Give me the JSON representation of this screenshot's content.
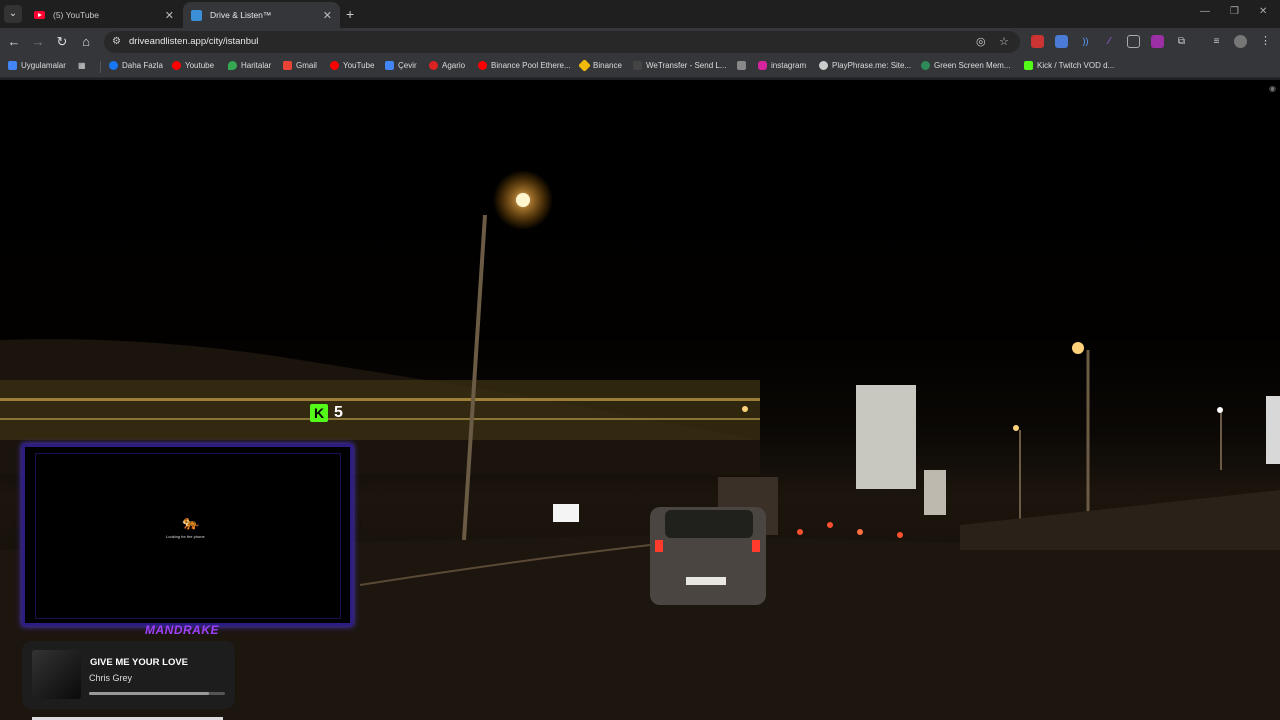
{
  "browser": {
    "tabs": [
      {
        "title": "(5) YouTube",
        "active": false
      },
      {
        "title": "Drive & Listen™",
        "active": true
      }
    ],
    "url": "driveandlisten.app/city/istanbul",
    "bookmarks": [
      {
        "label": "Uygulamalar",
        "icon": "apps-icon"
      },
      {
        "label": "Daha Fazla",
        "icon": "facebook-icon"
      },
      {
        "label": "Youtube",
        "icon": "youtube-icon"
      },
      {
        "label": "Haritalar",
        "icon": "maps-icon"
      },
      {
        "label": "Gmail",
        "icon": "gmail-icon"
      },
      {
        "label": "YouTube",
        "icon": "youtube-icon"
      },
      {
        "label": "Çevir",
        "icon": "translate-icon"
      },
      {
        "label": "Agario",
        "icon": "agario-icon"
      },
      {
        "label": "Binance Pool Ethere...",
        "icon": "youtube-icon"
      },
      {
        "label": "Binance",
        "icon": "binance-icon"
      },
      {
        "label": "WeTransfer - Send L...",
        "icon": "wetransfer-icon"
      },
      {
        "label": "",
        "icon": "bookmark-icon"
      },
      {
        "label": "instagram",
        "icon": "instagram-icon"
      },
      {
        "label": "PlayPhrase.me: Site...",
        "icon": "playphrase-icon"
      },
      {
        "label": "Green Screen Mem...",
        "icon": "greenscreen-icon"
      },
      {
        "label": "Kick / Twitch VOD d...",
        "icon": "kick-icon"
      }
    ]
  },
  "overlay": {
    "kick_viewers": "5",
    "webcam_caption": "Looking for the phone",
    "streamer_name": "MANDRAKE"
  },
  "player": {
    "song": "GIVE ME YOUR LOVE",
    "artist": "Chris Grey",
    "progress": 0.88
  }
}
